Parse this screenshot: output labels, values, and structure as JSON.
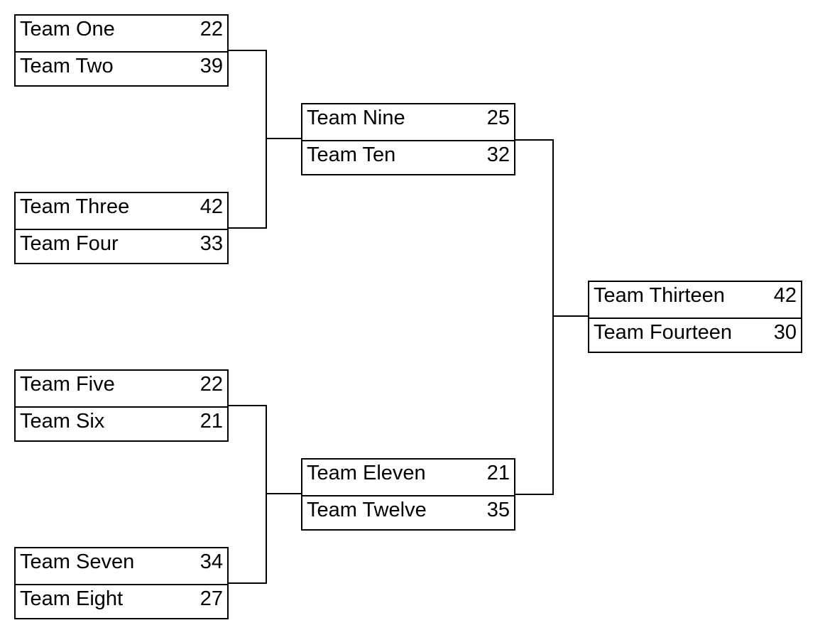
{
  "bracket": {
    "round1": [
      {
        "teams": [
          {
            "name": "Team One",
            "score": "22"
          },
          {
            "name": "Team Two",
            "score": "39"
          }
        ]
      },
      {
        "teams": [
          {
            "name": "Team Three",
            "score": "42"
          },
          {
            "name": "Team Four",
            "score": "33"
          }
        ]
      },
      {
        "teams": [
          {
            "name": "Team Five",
            "score": "22"
          },
          {
            "name": "Team Six",
            "score": "21"
          }
        ]
      },
      {
        "teams": [
          {
            "name": "Team Seven",
            "score": "34"
          },
          {
            "name": "Team Eight",
            "score": "27"
          }
        ]
      }
    ],
    "round2": [
      {
        "teams": [
          {
            "name": "Team Nine",
            "score": "25"
          },
          {
            "name": "Team Ten",
            "score": "32"
          }
        ]
      },
      {
        "teams": [
          {
            "name": "Team Eleven",
            "score": "21"
          },
          {
            "name": "Team Twelve",
            "score": "35"
          }
        ]
      }
    ],
    "round3": [
      {
        "teams": [
          {
            "name": "Team Thirteen",
            "score": "42"
          },
          {
            "name": "Team Fourteen",
            "score": "30"
          }
        ]
      }
    ]
  }
}
